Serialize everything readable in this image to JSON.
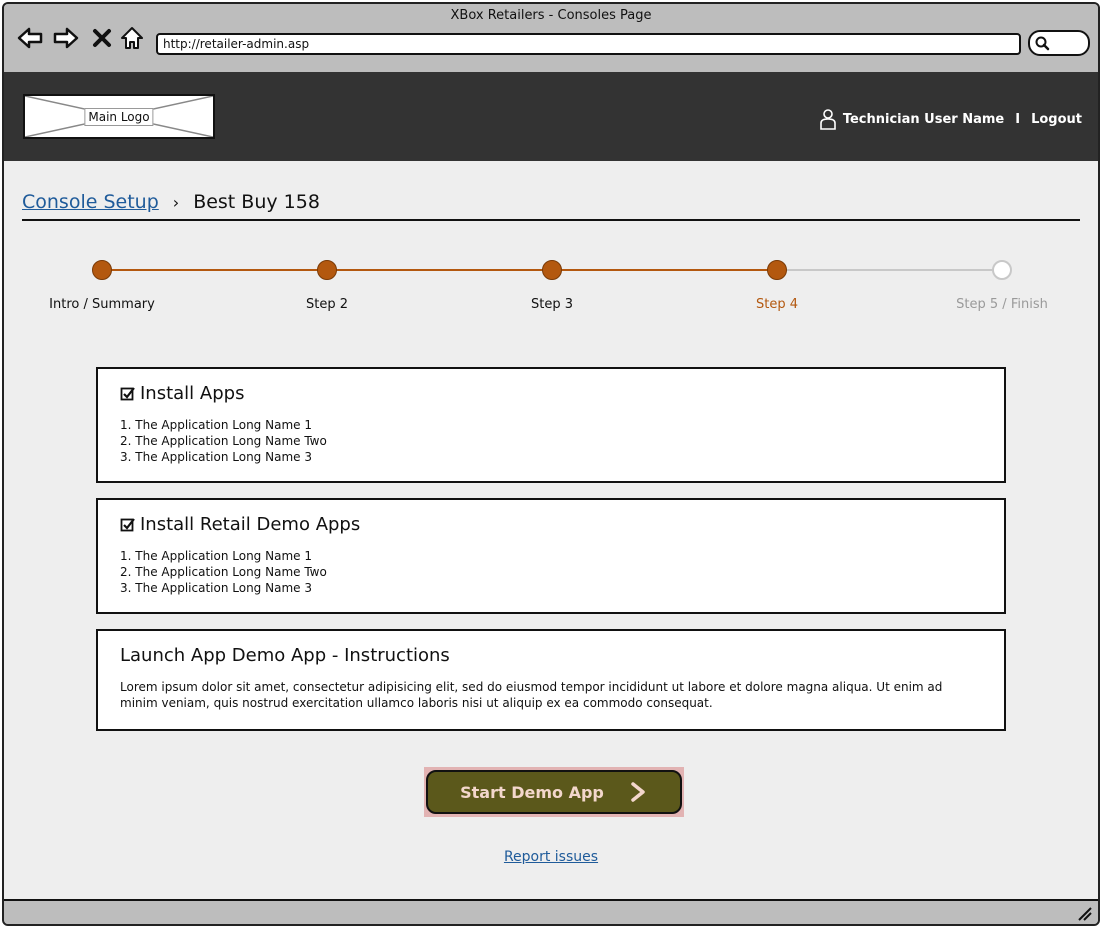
{
  "window": {
    "title": "XBox Retailers - Consoles Page"
  },
  "browser": {
    "url": "http://retailer-admin.asp"
  },
  "icons": {
    "back": "back-arrow-icon",
    "forward": "forward-arrow-icon",
    "stop": "close-icon",
    "home": "home-icon",
    "search": "search-icon",
    "user": "user-icon",
    "check": "checkbox-checked-icon",
    "chevron": "chevron-right-icon",
    "resize": "resize-grip-icon"
  },
  "header": {
    "logo_label": "Main Logo",
    "user_name": "Technician User Name",
    "separator": "I",
    "logout": "Logout"
  },
  "breadcrumb": {
    "link": "Console Setup",
    "chevron": "›",
    "current": "Best Buy 158"
  },
  "stepper": {
    "steps": [
      {
        "label": "Intro / Summary",
        "state": "complete"
      },
      {
        "label": "Step 2",
        "state": "complete"
      },
      {
        "label": "Step 3",
        "state": "complete"
      },
      {
        "label": "Step 4",
        "state": "current"
      },
      {
        "label": "Step 5 / Finish",
        "state": "pending"
      }
    ],
    "colors": {
      "active": "#b3580f",
      "inactive": "#c8c8c8",
      "label_default": "#111111",
      "label_pending": "#9a9a9a"
    }
  },
  "panels": {
    "install_apps": {
      "title": "Install Apps",
      "items": [
        "1. The Application Long Name 1",
        "2. The Application Long Name Two",
        "3. The Application Long Name 3"
      ]
    },
    "install_retail": {
      "title": "Install Retail Demo Apps",
      "items": [
        "1. The Application Long Name 1",
        "2. The Application Long Name Two",
        "3. The Application Long Name 3"
      ]
    },
    "instructions": {
      "title": "Launch App Demo App - Instructions",
      "body": "Lorem ipsum dolor sit amet, consectetur adipisicing elit, sed do eiusmod tempor incididunt ut labore et dolore magna aliqua. Ut enim ad minim veniam, quis nostrud exercitation ullamco laboris nisi ut aliquip ex ea commodo consequat."
    }
  },
  "actions": {
    "start_demo": "Start Demo App",
    "report_issues": "Report issues"
  },
  "colors": {
    "header_bg": "#333333",
    "cta_bg": "#5b581b",
    "cta_text": "#f3d7cc",
    "link": "#1f5b9a"
  }
}
